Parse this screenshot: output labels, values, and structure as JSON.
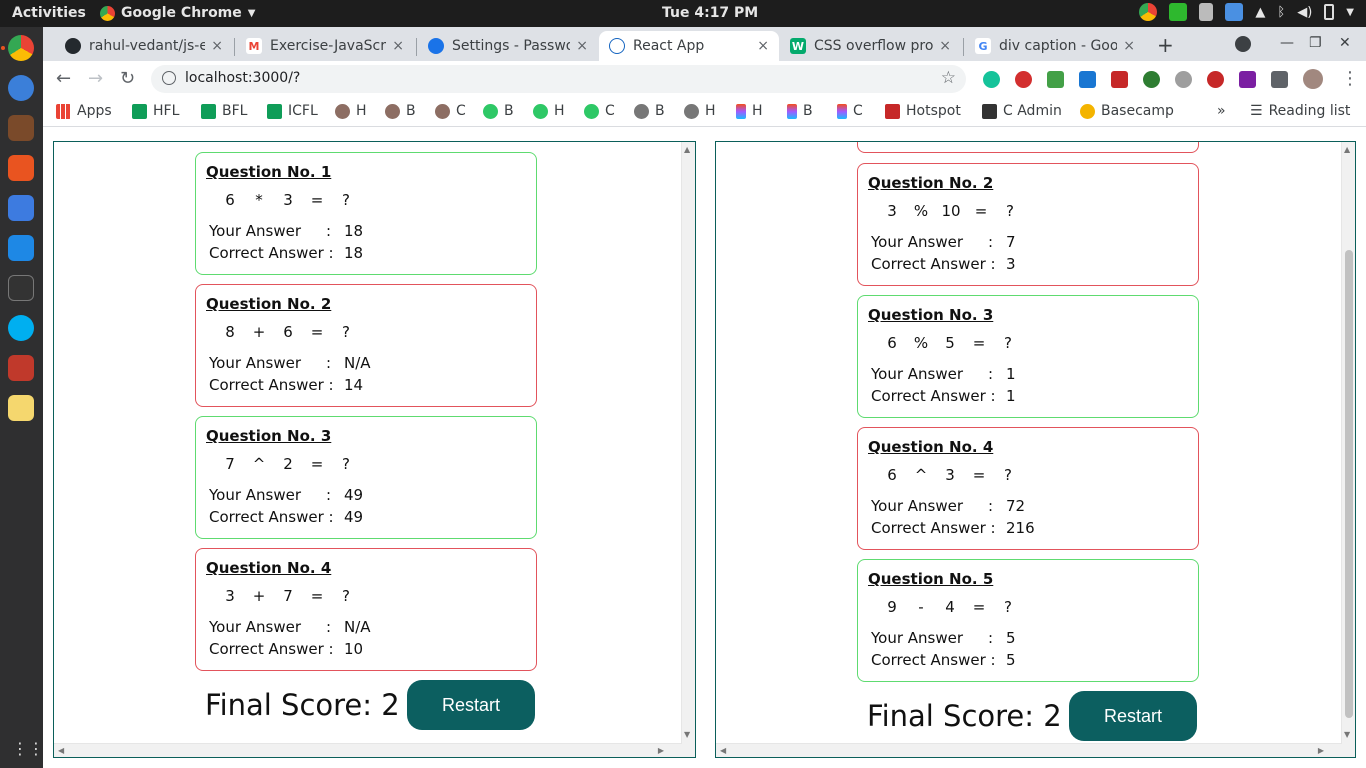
{
  "topbar": {
    "activities": "Activities",
    "app_name": "Google Chrome",
    "clock": "Tue  4:17 PM"
  },
  "tabs": [
    {
      "title": "rahul-vedant/js-e",
      "icon": "github-icon",
      "color": "#24292e"
    },
    {
      "title": "Exercise-JavaScri",
      "icon": "gmail-icon",
      "color": "#ea4335"
    },
    {
      "title": "Settings - Passwo",
      "icon": "gear-icon",
      "color": "#1a73e8"
    },
    {
      "title": "React App",
      "icon": "react-icon",
      "color": "#61dafb"
    },
    {
      "title": "CSS overflow pro",
      "icon": "w3schools-icon",
      "color": "#04aa6d"
    },
    {
      "title": "div caption - Goo",
      "icon": "google-icon",
      "color": "#4285f4"
    }
  ],
  "tab_close_glyph": "×",
  "new_tab_glyph": "+",
  "toolbar": {
    "url": "localhost:3000/?"
  },
  "bookmarks": [
    {
      "label": "Apps",
      "icon": "apps-grid-icon",
      "color": "#ea4335"
    },
    {
      "label": "HFL",
      "icon": "plus-icon",
      "color": "#0f9d58"
    },
    {
      "label": "BFL",
      "icon": "plus-icon",
      "color": "#0f9d58"
    },
    {
      "label": "ICFL",
      "icon": "plus-icon",
      "color": "#0f9d58"
    },
    {
      "label": "H",
      "icon": "avatar-icon",
      "color": "#8d6e63"
    },
    {
      "label": "B",
      "icon": "avatar-icon",
      "color": "#8d6e63"
    },
    {
      "label": "C",
      "icon": "avatar-icon",
      "color": "#8d6e63"
    },
    {
      "label": "B",
      "icon": "hackerrank-icon",
      "color": "#2ec866"
    },
    {
      "label": "H",
      "icon": "hackerrank-icon",
      "color": "#2ec866"
    },
    {
      "label": "C",
      "icon": "hackerrank-icon",
      "color": "#2ec866"
    },
    {
      "label": "B",
      "icon": "elephant-icon",
      "color": "#777777"
    },
    {
      "label": "H",
      "icon": "elephant-icon",
      "color": "#777777"
    },
    {
      "label": "H",
      "icon": "figma-icon",
      "color": "#f24e1e"
    },
    {
      "label": "B",
      "icon": "figma-icon",
      "color": "#f24e1e"
    },
    {
      "label": "C",
      "icon": "figma-icon",
      "color": "#f24e1e"
    },
    {
      "label": "Hotspot",
      "icon": "hotspot-icon",
      "color": "#c62828"
    },
    {
      "label": "C Admin",
      "icon": "cadmin-icon",
      "color": "#333333"
    },
    {
      "label": "Basecamp",
      "icon": "basecamp-icon",
      "color": "#f4b400"
    }
  ],
  "reading_list": "Reading list",
  "more_bookmarks_glyph": "»",
  "left_pane": {
    "questions": [
      {
        "title": "Question No. 1",
        "a": "6",
        "op": "*",
        "b": "3",
        "eq": "=",
        "q": "?",
        "your_label": "Your Answer",
        "your": "18",
        "correct_label": "Correct Answer :",
        "correct": "18",
        "status": "correct"
      },
      {
        "title": "Question No. 2",
        "a": "8",
        "op": "+",
        "b": "6",
        "eq": "=",
        "q": "?",
        "your_label": "Your Answer",
        "your": "N/A",
        "correct_label": "Correct Answer :",
        "correct": "14",
        "status": "wrong"
      },
      {
        "title": "Question No. 3",
        "a": "7",
        "op": "^",
        "b": "2",
        "eq": "=",
        "q": "?",
        "your_label": "Your Answer",
        "your": "49",
        "correct_label": "Correct Answer :",
        "correct": "49",
        "status": "correct"
      },
      {
        "title": "Question No. 4",
        "a": "3",
        "op": "+",
        "b": "7",
        "eq": "=",
        "q": "?",
        "your_label": "Your Answer",
        "your": "N/A",
        "correct_label": "Correct Answer :",
        "correct": "10",
        "status": "wrong"
      }
    ],
    "final_score": "Final Score: 2",
    "restart_label": "Restart"
  },
  "right_pane": {
    "questions": [
      {
        "title": "Question No. 2",
        "a": "3",
        "op": "%",
        "b": "10",
        "eq": "=",
        "q": "?",
        "your_label": "Your Answer",
        "your": "7",
        "correct_label": "Correct Answer :",
        "correct": "3",
        "status": "wrong"
      },
      {
        "title": "Question No. 3",
        "a": "6",
        "op": "%",
        "b": "5",
        "eq": "=",
        "q": "?",
        "your_label": "Your Answer",
        "your": "1",
        "correct_label": "Correct Answer :",
        "correct": "1",
        "status": "correct"
      },
      {
        "title": "Question No. 4",
        "a": "6",
        "op": "^",
        "b": "3",
        "eq": "=",
        "q": "?",
        "your_label": "Your Answer",
        "your": "72",
        "correct_label": "Correct Answer :",
        "correct": "216",
        "status": "wrong"
      },
      {
        "title": "Question No. 5",
        "a": "9",
        "op": "-",
        "b": "4",
        "eq": "=",
        "q": "?",
        "your_label": "Your Answer",
        "your": "5",
        "correct_label": "Correct Answer :",
        "correct": "5",
        "status": "correct"
      }
    ],
    "final_score": "Final Score: 2",
    "restart_label": "Restart"
  },
  "colors": {
    "correct_border": "#5edb70",
    "wrong_border": "#e2545c",
    "restart_bg": "#0c5f60",
    "frame_border": "#0b5f5a"
  }
}
